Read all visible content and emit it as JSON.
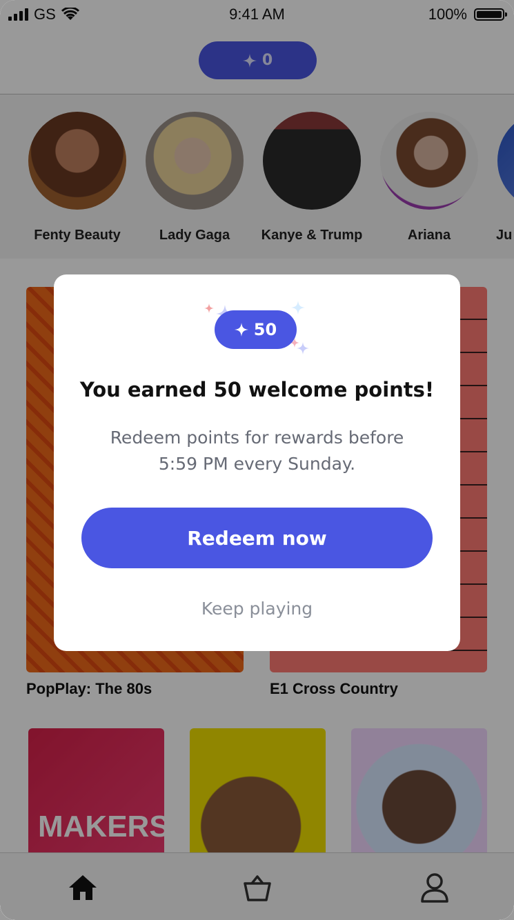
{
  "status_bar": {
    "carrier": "GS",
    "time": "9:41 AM",
    "battery": "100%"
  },
  "header": {
    "points_icon": "sparkle-icon",
    "points": "0"
  },
  "stories": [
    {
      "name": "Fenty Beauty"
    },
    {
      "name": "Lady Gaga"
    },
    {
      "name": "Kanye & Trump"
    },
    {
      "name": "Ariana"
    },
    {
      "name": "Ju"
    }
  ],
  "cards": [
    {
      "title": "PopPlay: The 80s"
    },
    {
      "title": "E1 Cross Country"
    }
  ],
  "bottom_cards": [
    {
      "text": "MAKERS"
    }
  ],
  "tabbar": {
    "icons": [
      "home-icon",
      "basket-icon",
      "profile-icon"
    ]
  },
  "modal": {
    "badge_points": "50",
    "title": "You earned 50 welcome points!",
    "description": "Redeem points for rewards before 5:59 PM every Sunday.",
    "primary_button": "Redeem now",
    "secondary_link": "Keep playing"
  },
  "colors": {
    "accent": "#4a56e2",
    "overlay": "rgba(0,0,0,0.40)"
  }
}
